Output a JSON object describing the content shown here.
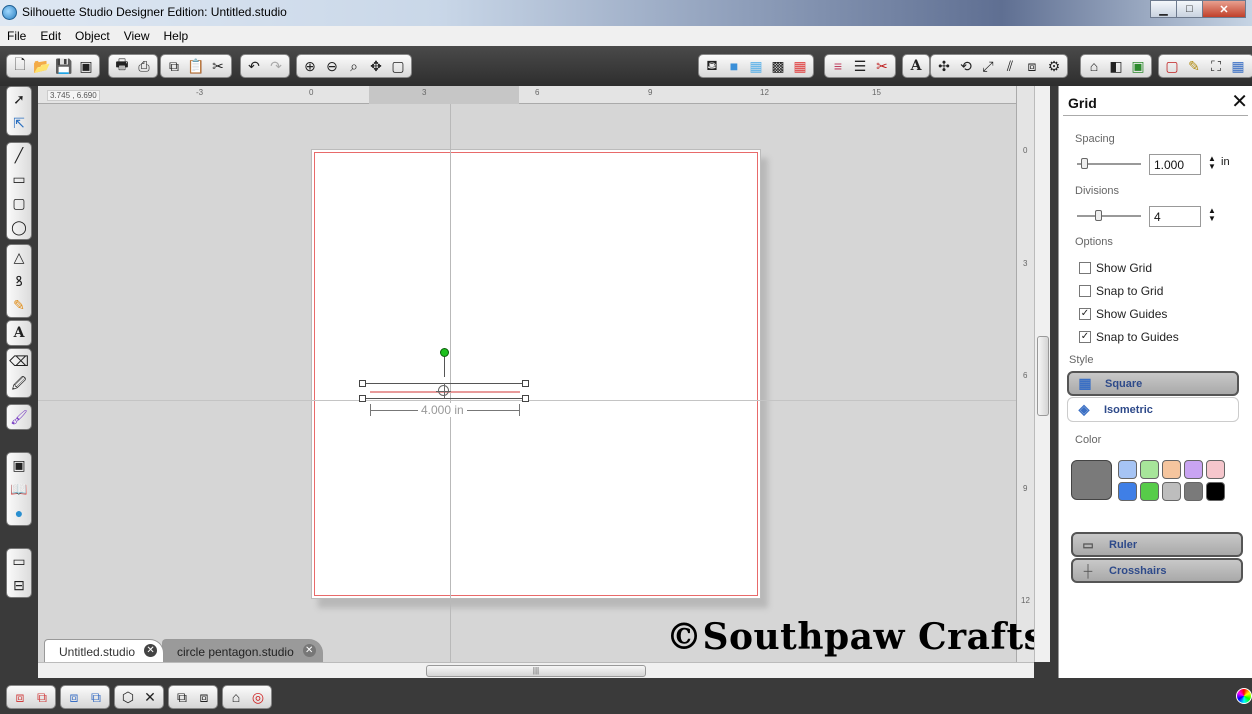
{
  "window": {
    "title": "Silhouette Studio Designer Edition: Untitled.studio",
    "minimize": "▁",
    "maximize": "□",
    "close": "✕"
  },
  "menu": [
    "File",
    "Edit",
    "Object",
    "View",
    "Help"
  ],
  "canvas": {
    "coordinates": "3.745 , 6.690",
    "ruler_top": [
      "-3",
      "0",
      "3",
      "6",
      "9",
      "12",
      "15"
    ],
    "ruler_side": [
      "0",
      "3",
      "6",
      "9",
      "12"
    ],
    "dimension_label": "4.000 in",
    "watermark": "©Southpaw Crafts",
    "scroll_grip": "|||"
  },
  "tabs": [
    {
      "label": "Untitled.studio",
      "close": "✕"
    },
    {
      "label": "circle pentagon.studio",
      "close": "✕"
    }
  ],
  "panel": {
    "title": "Grid",
    "close": "✕",
    "spacing_label": "Spacing",
    "spacing_value": "1.000",
    "spacing_unit": "in",
    "divisions_label": "Divisions",
    "divisions_value": "4",
    "options_label": "Options",
    "options": [
      {
        "label": "Show Grid",
        "checked": false
      },
      {
        "label": "Snap to Grid",
        "checked": false
      },
      {
        "label": "Show Guides",
        "checked": true
      },
      {
        "label": "Snap to Guides",
        "checked": true
      }
    ],
    "style_label": "Style",
    "styles": [
      {
        "label": "Square",
        "selected": true
      },
      {
        "label": "Isometric",
        "selected": false
      }
    ],
    "color_label": "Color",
    "selected_color": "#7a7a7a",
    "swatches": [
      "#a6c4f4",
      "#a7e59a",
      "#f5c59e",
      "#c9a4f2",
      "#f5c6cc",
      "#3f7fe6",
      "#57cc49",
      "#bdbdbd",
      "#7a7a7a",
      "#000000"
    ],
    "ruler_button": "Ruler",
    "crosshairs_button": "Crosshairs"
  }
}
